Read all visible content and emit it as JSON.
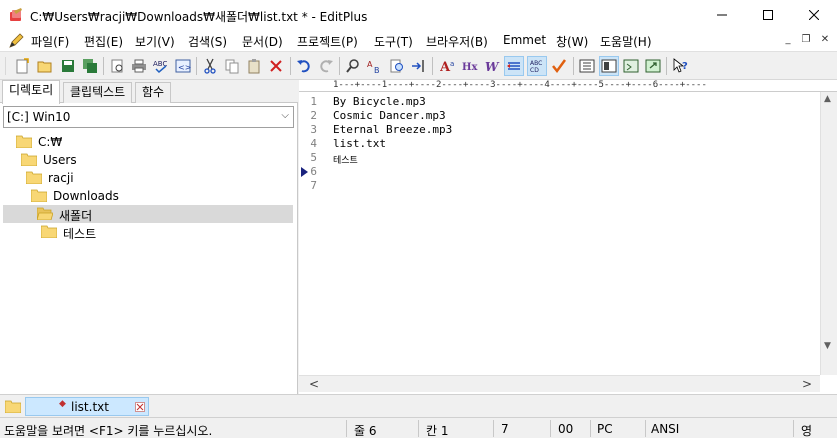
{
  "window": {
    "title": "C:₩Users₩racji₩Downloads₩새폴더₩list.txt * - EditPlus"
  },
  "menu": [
    "파일(F)",
    "편집(E)",
    "보기(V)",
    "검색(S)",
    "문서(D)",
    "프로젝트(P)",
    "도구(T)",
    "브라우저(B)",
    "Emmet",
    "창(W)",
    "도움말(H)"
  ],
  "left_panel": {
    "tabs": [
      "디렉토리",
      "클립텍스트",
      "함수"
    ],
    "drive": "[C:] Win10",
    "tree": [
      "C:₩",
      "Users",
      "racji",
      "Downloads",
      "새폴더",
      "테스트"
    ]
  },
  "editor": {
    "ruler": "1---+----1----+----2----+----3----+----4----+----5----+----6----+----",
    "line_numbers": [
      "1",
      "2",
      "3",
      "4",
      "5",
      "6",
      "7"
    ],
    "lines": [
      "By Bicycle.mp3",
      "Cosmic Dancer.mp3",
      "Eternal Breeze.mp3",
      "list.txt",
      "테스트",
      "",
      ""
    ]
  },
  "doc_tab": {
    "label": "list.txt"
  },
  "status": {
    "help": "도움말을 보려면 <F1> 키를 누르십시오.",
    "line": "줄 6",
    "col": "칸 1",
    "count": "7",
    "code": "00",
    "eol": "PC",
    "encoding": "ANSI",
    "ime": "영"
  },
  "colors": {
    "accent": "#0078d7",
    "selection": "#d9d9d9",
    "folder": "#f8d775"
  }
}
